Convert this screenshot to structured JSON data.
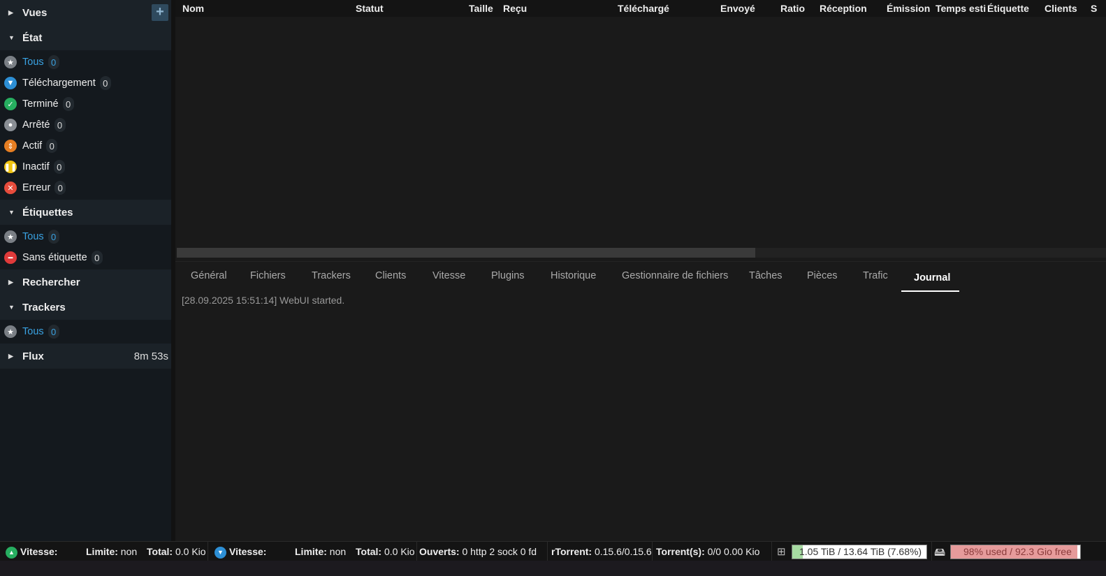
{
  "sidebar": {
    "views": {
      "label": "Vues",
      "add_symbol": "+"
    },
    "state": {
      "label": "État",
      "items": [
        {
          "label": "Tous",
          "count": "0",
          "icon": "star-icon"
        },
        {
          "label": "Téléchargement",
          "count": "0",
          "icon": "download-icon"
        },
        {
          "label": "Terminé",
          "count": "0",
          "icon": "check-icon"
        },
        {
          "label": "Arrêté",
          "count": "0",
          "icon": "stopped-icon"
        },
        {
          "label": "Actif",
          "count": "0",
          "icon": "updown-icon"
        },
        {
          "label": "Inactif",
          "count": "0",
          "icon": "pause-icon"
        },
        {
          "label": "Erreur",
          "count": "0",
          "icon": "error-icon"
        }
      ]
    },
    "labels": {
      "label": "Étiquettes",
      "items": [
        {
          "label": "Tous",
          "count": "0",
          "icon": "star-icon"
        },
        {
          "label": "Sans étiquette",
          "count": "0",
          "icon": "no-label-icon"
        }
      ]
    },
    "search": {
      "label": "Rechercher"
    },
    "trackers": {
      "label": "Trackers",
      "items": [
        {
          "label": "Tous",
          "count": "0",
          "icon": "star-icon"
        }
      ]
    },
    "feeds": {
      "label": "Flux",
      "time": "8m 53s"
    }
  },
  "table": {
    "columns": [
      "Nom",
      "Statut",
      "Taille",
      "Reçu",
      "Téléchargé",
      "Envoyé",
      "Ratio",
      "Réception",
      "Émission",
      "Temps esti",
      "Étiquette",
      "Clients",
      "S"
    ]
  },
  "tabs": [
    "Général",
    "Fichiers",
    "Trackers",
    "Clients",
    "Vitesse",
    "Plugins",
    "Historique",
    "Gestionnaire de fichiers",
    "Tâches",
    "Pièces",
    "Trafic",
    "Journal"
  ],
  "active_tab": "Journal",
  "log": {
    "line": "[28.09.2025 15:51:14] WebUI started."
  },
  "statusbar": {
    "up": {
      "speed_label": "Vitesse:",
      "limit_label": "Limite:",
      "limit_value": "non",
      "total_label": "Total:",
      "total_value": "0.0 Kio"
    },
    "down": {
      "speed_label": "Vitesse:",
      "limit_label": "Limite:",
      "limit_value": "non",
      "total_label": "Total:",
      "total_value": "0.0 Kio"
    },
    "open": {
      "label": "Ouverts:",
      "value": "0 http  2 sock 0 fd"
    },
    "rtorrent": {
      "label": "rTorrent:",
      "value": "0.15.6/0.15.6"
    },
    "torrents": {
      "label": "Torrent(s):",
      "value": "0/0   0.00 Kio"
    },
    "disk1": {
      "text": "1.05 TiB / 13.64 TiB (7.68%)",
      "fraction": 0.0768
    },
    "disk2": {
      "text": "98% used / 92.3 Gio free",
      "fraction": 0.98
    }
  },
  "colors": {
    "accent": "#3aa3e3",
    "sidebar_bg": "#14191e",
    "main_bg": "#1a1a1a"
  }
}
